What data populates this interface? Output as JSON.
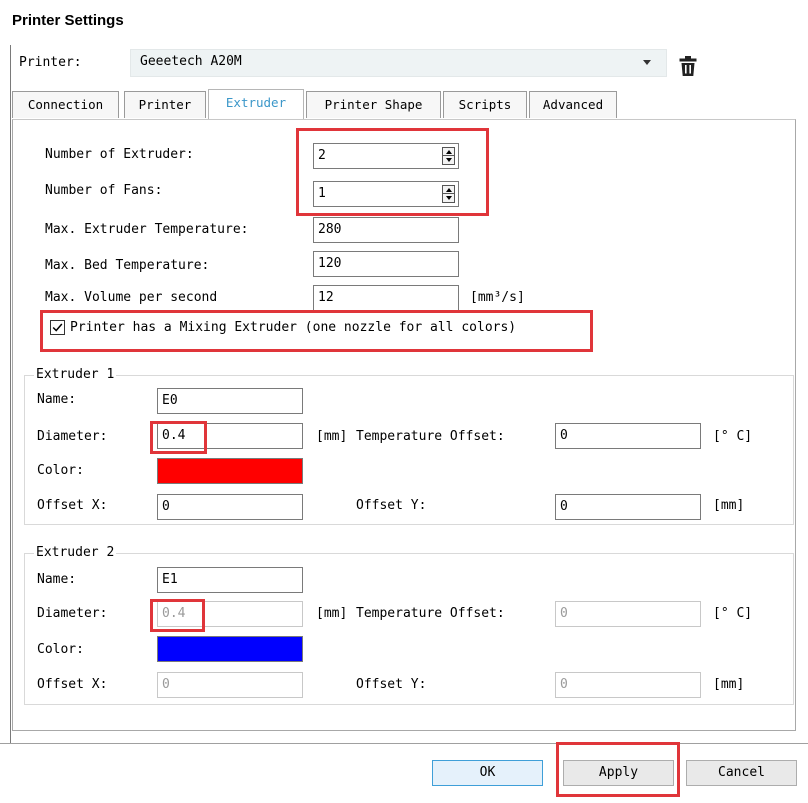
{
  "window": {
    "title": "Printer Settings"
  },
  "printer": {
    "label": "Printer:",
    "value": "Geeetech A20M"
  },
  "icons": {
    "dropdown": "chevron-down-icon",
    "delete": "trash-icon",
    "checkbox": "check-icon"
  },
  "tabs": [
    {
      "label": "Connection"
    },
    {
      "label": "Printer"
    },
    {
      "label": "Extruder"
    },
    {
      "label": "Printer Shape"
    },
    {
      "label": "Scripts"
    },
    {
      "label": "Advanced"
    }
  ],
  "active_tab": "Extruder",
  "extruder_settings": {
    "num_extruders": {
      "label": "Number of Extruder:",
      "value": "2"
    },
    "num_fans": {
      "label": "Number of Fans:",
      "value": "1"
    },
    "max_extruder_temp": {
      "label": "Max. Extruder Temperature:",
      "value": "280"
    },
    "max_bed_temp": {
      "label": "Max. Bed Temperature:",
      "value": "120"
    },
    "max_volume": {
      "label": "Max. Volume per second",
      "value": "12",
      "unit": "[mm³/s]"
    },
    "mixing": {
      "label": "Printer has a Mixing Extruder (one nozzle for all colors)",
      "checked": true
    }
  },
  "extruder1": {
    "title": "Extruder 1",
    "name_label": "Name:",
    "name": "E0",
    "diameter_label": "Diameter:",
    "diameter": "0.4",
    "diameter_unit": "[mm]",
    "temp_offset_label": "Temperature Offset:",
    "temp_offset": "0",
    "temp_unit": "[° C]",
    "color_label": "Color:",
    "color": "#ff0000",
    "offset_x_label": "Offset X:",
    "offset_x": "0",
    "offset_y_label": "Offset Y:",
    "offset_y": "0",
    "offset_unit": "[mm]"
  },
  "extruder2": {
    "title": "Extruder 2",
    "name_label": "Name:",
    "name": "E1",
    "diameter_label": "Diameter:",
    "diameter": "0.4",
    "diameter_unit": "[mm]",
    "temp_offset_label": "Temperature Offset:",
    "temp_offset": "0",
    "temp_unit": "[° C]",
    "color_label": "Color:",
    "color": "#0000ff",
    "offset_x_label": "Offset X:",
    "offset_x": "0",
    "offset_y_label": "Offset Y:",
    "offset_y": "0",
    "offset_unit": "[mm]"
  },
  "buttons": {
    "ok": "OK",
    "apply": "Apply",
    "cancel": "Cancel"
  },
  "colors": {
    "highlight": "#e0353a",
    "tab_active": "#3b97c9",
    "button_border": "#3f9fd8"
  }
}
